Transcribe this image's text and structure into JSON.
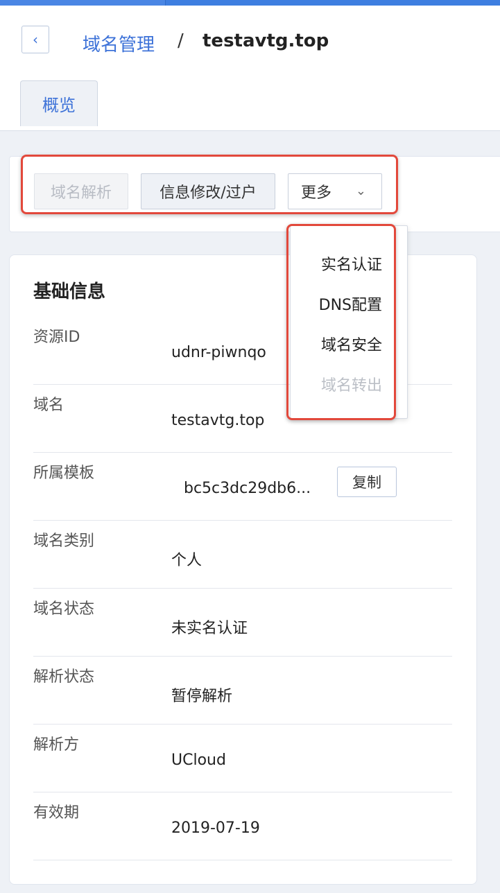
{
  "breadcrumb": {
    "parent": "域名管理",
    "separator": "/",
    "current": "testavtg.top"
  },
  "tabs": [
    {
      "label": "概览",
      "active": true
    }
  ],
  "actions": {
    "dns_resolve": "域名解析",
    "info_edit": "信息修改/过户",
    "more": "更多"
  },
  "dropdown": {
    "items": [
      {
        "label": "实名认证",
        "disabled": false
      },
      {
        "label": "DNS配置",
        "disabled": false
      },
      {
        "label": "域名安全",
        "disabled": false
      },
      {
        "label": "域名转出",
        "disabled": true
      }
    ]
  },
  "basic_info": {
    "title": "基础信息",
    "rows": [
      {
        "label": "资源ID",
        "value": "udnr-piwnqo"
      },
      {
        "label": "域名",
        "value": "testavtg.top"
      },
      {
        "label": "所属模板",
        "value": "bc5c3dc29db6...",
        "copy_label": "复制"
      },
      {
        "label": "域名类别",
        "value": "个人"
      },
      {
        "label": "域名状态",
        "value": "未实名认证"
      },
      {
        "label": "解析状态",
        "value": "暂停解析"
      },
      {
        "label": "解析方",
        "value": "UCloud"
      },
      {
        "label": "有效期",
        "value": "2019-07-19"
      }
    ]
  },
  "colors": {
    "accent": "#3d72d8",
    "highlight": "#e2483b",
    "disabled": "#bbbfc6"
  }
}
